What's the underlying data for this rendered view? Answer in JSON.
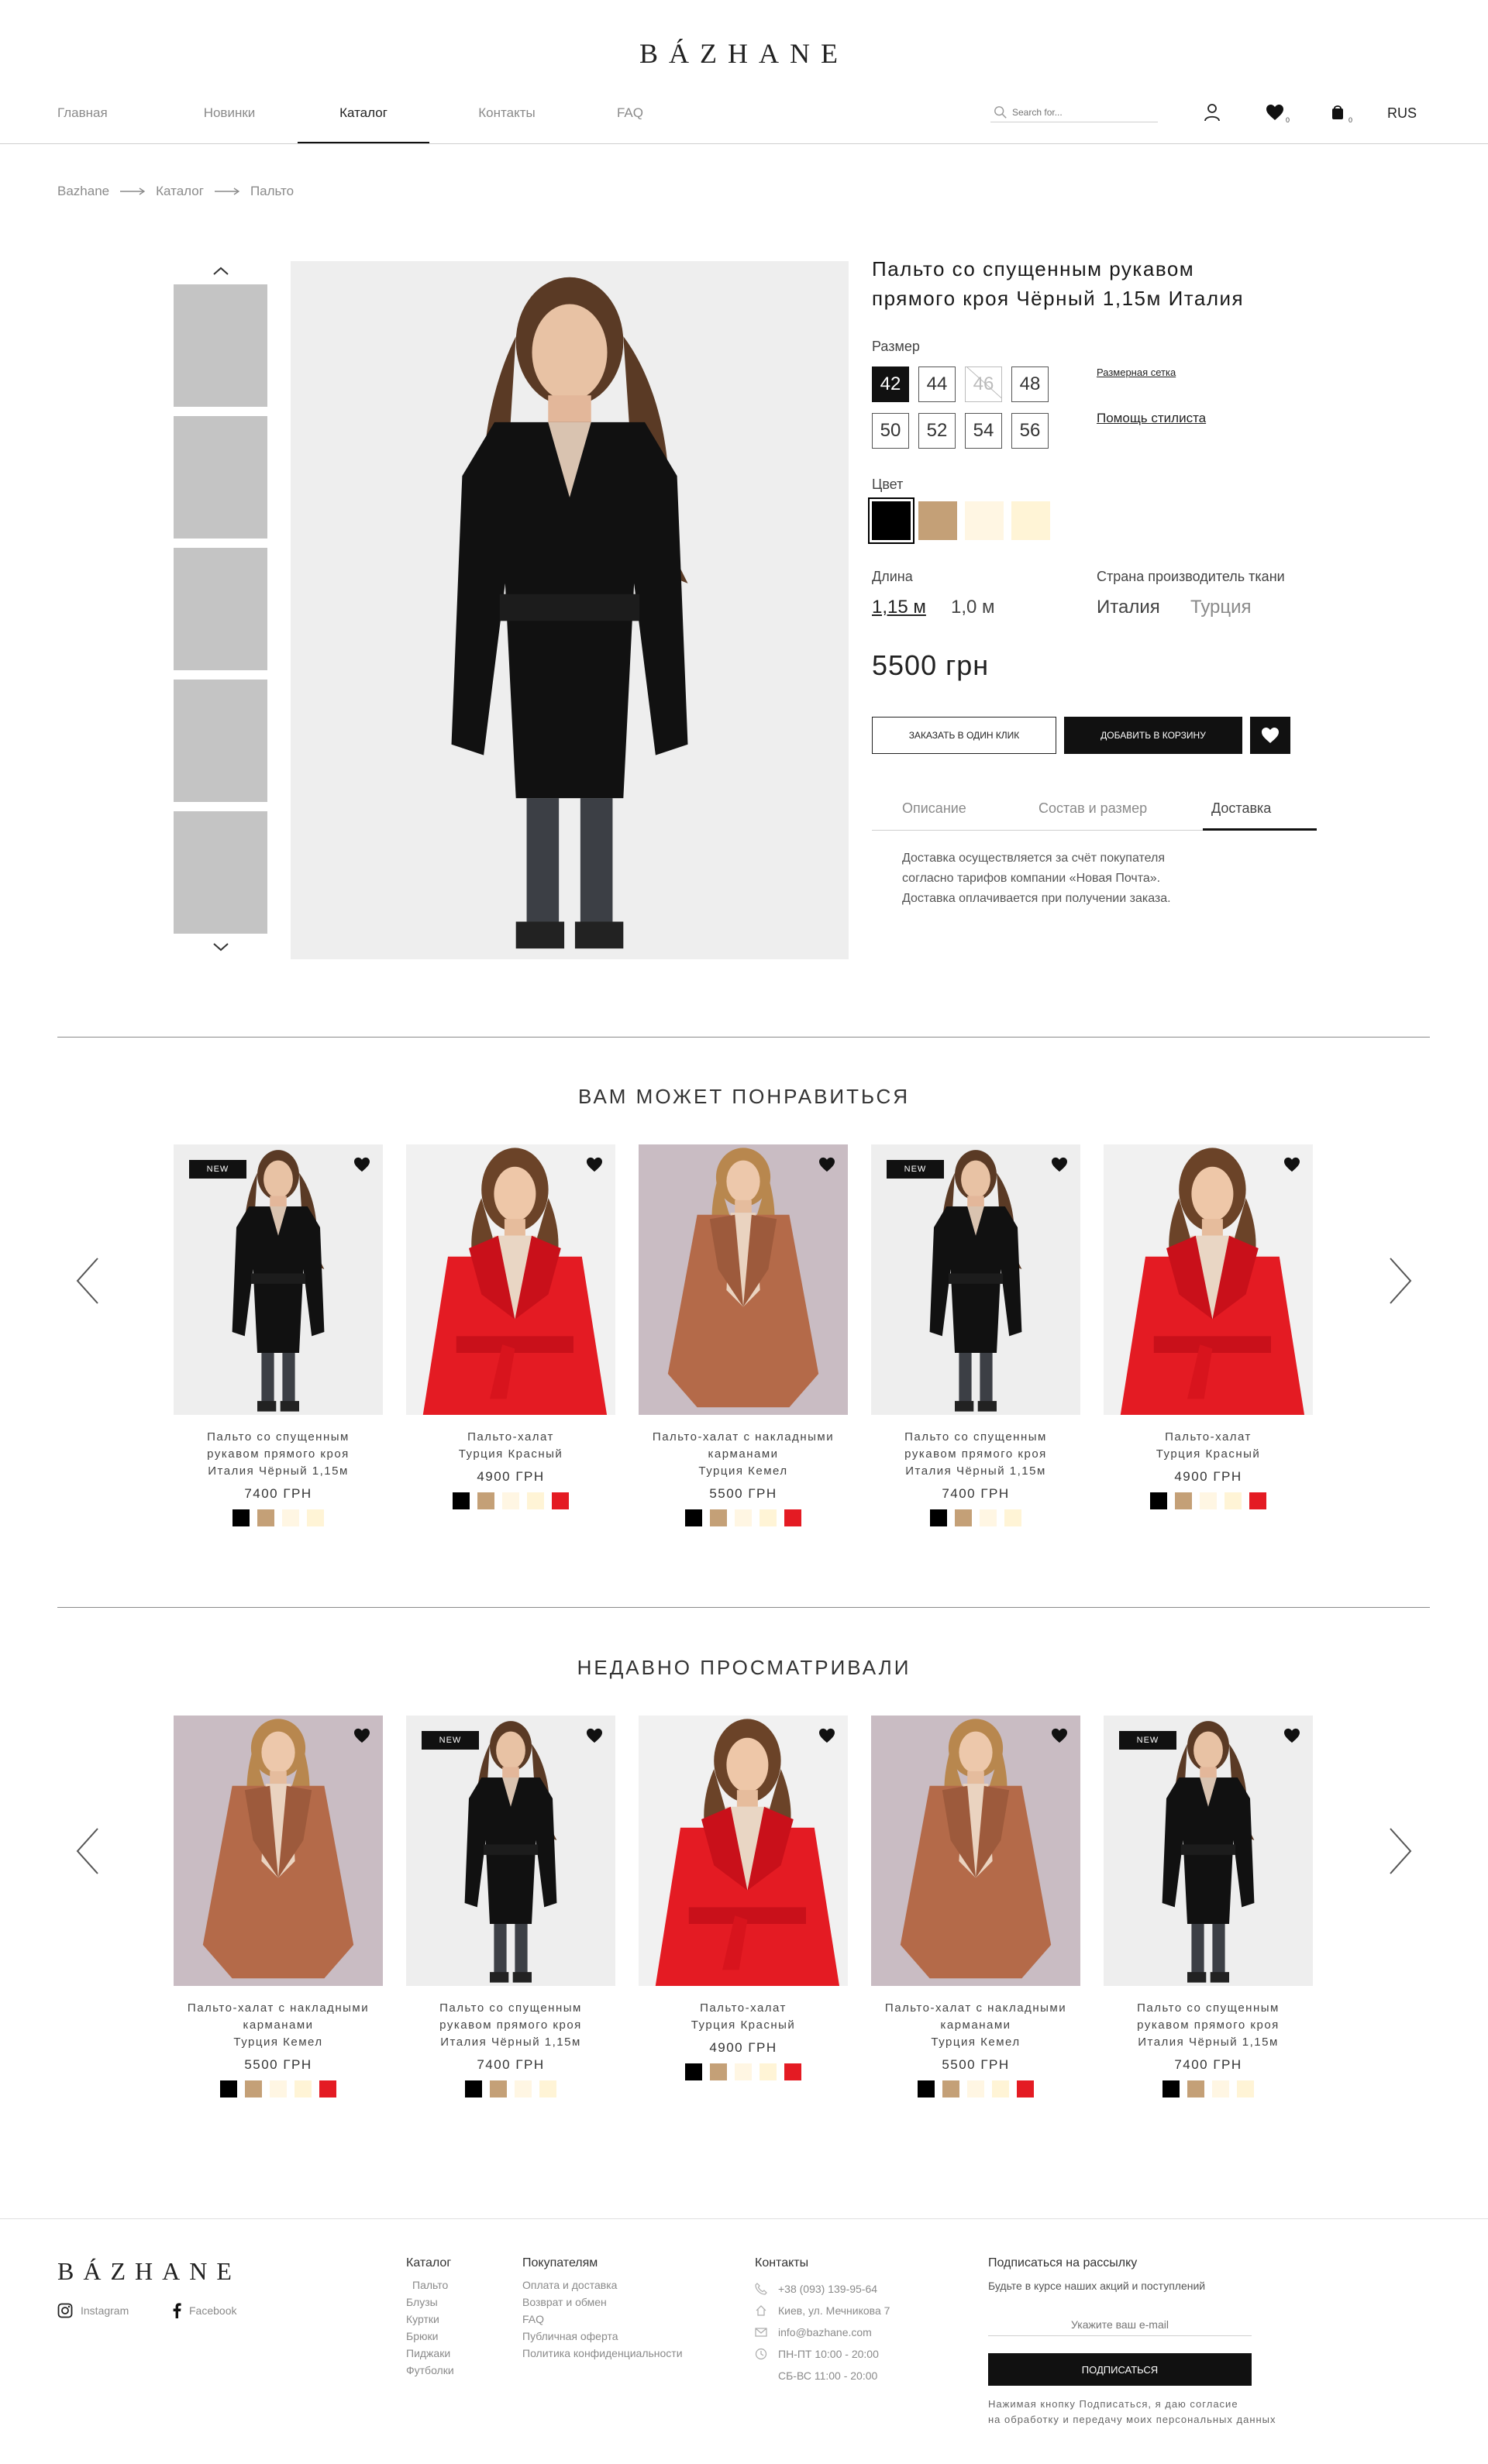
{
  "header": {
    "logo": "BÁZHANE",
    "nav": [
      "Главная",
      "Новинки",
      "Каталог",
      "Контакты",
      "FAQ"
    ],
    "search_placeholder": "Search for...",
    "wishlist_count": "0",
    "cart_count": "0",
    "language": "RUS"
  },
  "breadcrumb": [
    "Bazhane",
    "Каталог",
    "Пальто"
  ],
  "product": {
    "title_line1": "Пальто со спущенным рукавом",
    "title_line2": "прямого кроя Чёрный 1,15м Италия",
    "size_label": "Размер",
    "sizes": [
      "42",
      "44",
      "46",
      "48",
      "50",
      "52",
      "54",
      "56"
    ],
    "size_chart_link": "Размерная сетка",
    "stylist_link": "Помощь стилиста",
    "color_label": "Цвет",
    "colors": [
      "#000000",
      "#c4a077",
      "#fff6e3",
      "#fff4d6"
    ],
    "length_label": "Длина",
    "lengths": [
      "1,15 м",
      "1,0 м"
    ],
    "country_label": "Страна производитель ткани",
    "countries": [
      "Италия",
      "Турция"
    ],
    "price": "5500 грн",
    "one_click": "ЗАКАЗАТЬ В ОДИН КЛИК",
    "add_to_cart": "ДОБАВИТЬ В КОРЗИНУ",
    "tabs": [
      "Описание",
      "Состав и размер",
      "Доставка"
    ],
    "delivery_lines": [
      "Доставка осуществляется за счёт покупателя",
      "согласно тарифов компании «Новая Почта».",
      "Доставка оплачивается при получении заказа."
    ]
  },
  "recommended": {
    "title": "ВАМ МОЖЕТ ПОНРАВИТЬСЯ",
    "items": [
      {
        "new": "NEW",
        "name1": "Пальто со спущенным",
        "name2": "рукавом прямого кроя",
        "name3": "Италия Чёрный 1,15м",
        "price": "7400 ГРН"
      },
      {
        "new": "",
        "name1": "Пальто-халат",
        "name2": "Турция Красный",
        "name3": "",
        "price": "4900 ГРН"
      },
      {
        "new": "",
        "name1": "Пальто-халат с накладными",
        "name2": "карманами",
        "name3": "Турция Кемел",
        "price": "5500 ГРН"
      },
      {
        "new": "NEW",
        "name1": "Пальто со спущенным",
        "name2": "рукавом прямого кроя",
        "name3": "Италия Чёрный 1,15м",
        "price": "7400 ГРН"
      },
      {
        "new": "",
        "name1": "Пальто-халат",
        "name2": "Турция Красный",
        "name3": "",
        "price": "4900 ГРН"
      }
    ]
  },
  "recent": {
    "title": "НЕДАВНО ПРОСМАТРИВАЛИ",
    "items": [
      {
        "new": "",
        "name1": "Пальто-халат с накладными",
        "name2": "карманами",
        "name3": "Турция Кемел",
        "price": "5500 ГРН"
      },
      {
        "new": "NEW",
        "name1": "Пальто со спущенным",
        "name2": "рукавом прямого кроя",
        "name3": "Италия Чёрный 1,15м",
        "price": "7400 ГРН"
      },
      {
        "new": "",
        "name1": "Пальто-халат",
        "name2": "Турция Красный",
        "name3": "",
        "price": "4900 ГРН"
      },
      {
        "new": "",
        "name1": "Пальто-халат с накладными",
        "name2": "карманами",
        "name3": "Турция Кемел",
        "price": "5500 ГРН"
      },
      {
        "new": "NEW",
        "name1": "Пальто со спущенным",
        "name2": "рукавом прямого кроя",
        "name3": "Италия Чёрный 1,15м",
        "price": "7400 ГРН"
      }
    ]
  },
  "footer": {
    "logo": "BÁZHANE",
    "instagram": "Instagram",
    "facebook": "Facebook",
    "catalog_title": "Каталог",
    "catalog_items": [
      "Пальто",
      "Блузы",
      "Куртки",
      "Брюки",
      "Пиджаки",
      "Футболки"
    ],
    "buyers_title": "Покупателям",
    "buyers_items": [
      "Оплата и доставка",
      "Возврат и обмен",
      "FAQ",
      "Публичная оферта",
      "Политика конфиденциальности"
    ],
    "contacts_title": "Контакты",
    "phone": "+38 (093) 139-95-64",
    "address": "Киев, ул. Мечникова 7",
    "email": "info@bazhane.com",
    "hours1": "ПН-ПТ 10:00 - 20:00",
    "hours2": "СБ-ВС 11:00 - 20:00",
    "newsletter_title": "Подписаться на рассылку",
    "newsletter_sub": "Будьте в курсе наших акций и поступлений",
    "email_placeholder": "Укажите ваш e-mail",
    "subscribe": "ПОДПИСАТЬСЯ",
    "consent1": "Нажимая кнопку Подписаться, я даю согласие",
    "consent2": "на обработку и передачу моих персональных данных"
  }
}
